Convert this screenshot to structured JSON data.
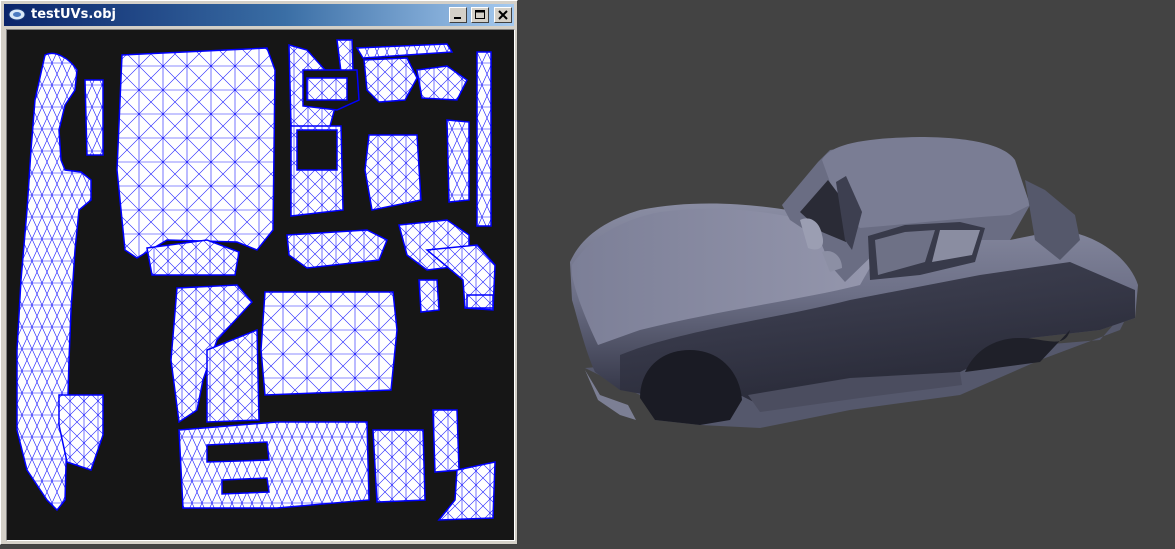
{
  "window": {
    "title": "testUVs.obj",
    "app_icon": "obj-viewer-icon",
    "buttons": {
      "minimize": "minimize-icon",
      "maximize": "maximize-icon",
      "close": "close-icon"
    }
  },
  "uv_editor": {
    "content": "uv-layout-wireframe",
    "background_color": "#161616",
    "island_fill": "#ffffff",
    "edge_color": "#0000ff"
  },
  "viewport": {
    "content": "car-body-3d-model",
    "background_color": "#434343",
    "model_color": "#6f7288"
  }
}
